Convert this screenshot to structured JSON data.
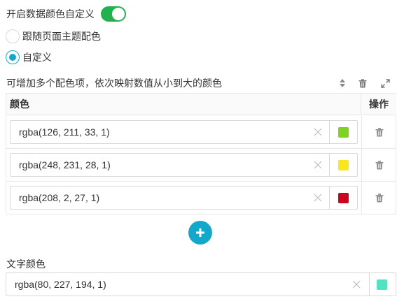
{
  "toggle": {
    "label": "开启数据颜色自定义",
    "on": true,
    "color": "#22b14c"
  },
  "radios": [
    {
      "label": "跟随页面主题配色",
      "checked": false
    },
    {
      "label": "自定义",
      "checked": true
    }
  ],
  "hint": "可增加多个配色项，依次映射数值从小到大的颜色",
  "toolbar": {
    "icons": [
      "sort-icon",
      "trash-icon",
      "expand-icon"
    ]
  },
  "table": {
    "headers": {
      "color": "颜色",
      "operation": "操作"
    },
    "rows": [
      {
        "value": "rgba(126, 211, 33, 1)",
        "swatch": "#7ed321"
      },
      {
        "value": "rgba(248, 231, 28, 1)",
        "swatch": "#f8e71c"
      },
      {
        "value": "rgba(208, 2, 27, 1)",
        "swatch": "#d0021b"
      }
    ]
  },
  "text_color": {
    "label": "文字颜色",
    "value": "rgba(80, 227, 194, 1)",
    "swatch": "#50e3c2"
  },
  "accent": "#13a8c9"
}
